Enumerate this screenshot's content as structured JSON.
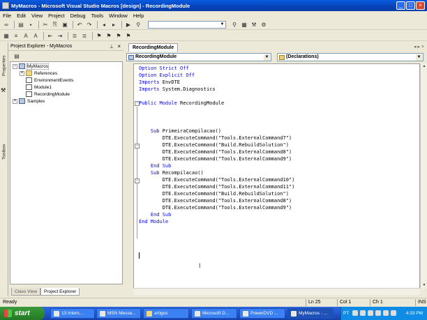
{
  "window": {
    "title": "MyMacros - Microsoft Visual Studio Macros [design] - RecordingModule",
    "caption_buttons": [
      "minimize",
      "maximize",
      "close"
    ]
  },
  "menu": [
    "File",
    "Edit",
    "View",
    "Project",
    "Debug",
    "Tools",
    "Window",
    "Help"
  ],
  "side_strip": {
    "properties": "Properties",
    "toolbox": "Toolbox"
  },
  "project_explorer": {
    "title": "Project Explorer - MyMacros",
    "tree": [
      {
        "label": "MyMacros",
        "level": 0,
        "expander": "−",
        "icon": "project",
        "selected": true
      },
      {
        "label": "References",
        "level": 1,
        "expander": "+",
        "icon": "folder"
      },
      {
        "label": "EnvironmentEvents",
        "level": 1,
        "expander": "",
        "icon": "module"
      },
      {
        "label": "Module1",
        "level": 1,
        "expander": "",
        "icon": "module"
      },
      {
        "label": "RecordingModule",
        "level": 1,
        "expander": "",
        "icon": "module"
      },
      {
        "label": "Samples",
        "level": 0,
        "expander": "+",
        "icon": "project"
      }
    ],
    "tabs": [
      "Class View",
      "Project Explorer"
    ]
  },
  "editor": {
    "tab": "RecordingModule",
    "class_combo": "RecordingModule",
    "member_combo": "(Declarations)",
    "code": [
      [
        [
          "kw",
          "Option Strict Off"
        ]
      ],
      [
        [
          "kw",
          "Option Explicit Off"
        ]
      ],
      [
        [
          "kw",
          "Imports"
        ],
        [
          "",
          " EnvDTE"
        ]
      ],
      [
        [
          "kw",
          "Imports"
        ],
        [
          "",
          " System.Diagnostics"
        ]
      ],
      [],
      [
        [
          "kw",
          "Public Module"
        ],
        [
          "",
          " RecordingModule"
        ]
      ],
      [],
      [],
      [],
      [
        [
          "",
          "    "
        ],
        [
          "kw",
          "Sub"
        ],
        [
          "",
          " PrimeiraCompilacao()"
        ]
      ],
      [
        [
          "",
          "        DTE.ExecuteCommand(\"Tools.ExternalCommand7\")"
        ]
      ],
      [
        [
          "",
          "        DTE.ExecuteCommand(\"Build.RebuildSolution\")"
        ]
      ],
      [
        [
          "",
          "        DTE.ExecuteCommand(\"Tools.ExternalCommand8\")"
        ]
      ],
      [
        [
          "",
          "        DTE.ExecuteCommand(\"Tools.ExternalCommand9\")"
        ]
      ],
      [
        [
          "",
          "    "
        ],
        [
          "kw",
          "End Sub"
        ]
      ],
      [
        [
          "",
          "    "
        ],
        [
          "kw",
          "Sub"
        ],
        [
          "",
          " Recompilacao()"
        ]
      ],
      [
        [
          "",
          "        DTE.ExecuteCommand(\"Tools.ExternalCommand10\")"
        ]
      ],
      [
        [
          "",
          "        DTE.ExecuteCommand(\"Tools.ExternalCommand11\")"
        ]
      ],
      [
        [
          "",
          "        DTE.ExecuteCommand(\"Build.RebuildSolution\")"
        ]
      ],
      [
        [
          "",
          "        DTE.ExecuteCommand(\"Tools.ExternalCommand8\")"
        ]
      ],
      [
        [
          "",
          "        DTE.ExecuteCommand(\"Tools.ExternalCommand9\")"
        ]
      ],
      [
        [
          "",
          "    "
        ],
        [
          "kw",
          "End Sub"
        ]
      ],
      [
        [
          "kw",
          "End Module"
        ]
      ]
    ]
  },
  "status": {
    "text": "Ready",
    "line": "Ln 25",
    "col": "Col 1",
    "ch": "Ch 1",
    "mode": "INS"
  },
  "taskbar": {
    "start": "start",
    "tasks": [
      "13 Intern...",
      "MSN Messe...",
      "artigos",
      "Microsoft D...",
      "PowerDVD ...",
      "MyMacros - ..."
    ],
    "lang": "PT",
    "clock": "4:33 PM"
  },
  "colors": {
    "keyword": "#0000ff",
    "title_bar": "#0842b8",
    "taskbar": "#245edb",
    "start": "#2e8b2e"
  }
}
